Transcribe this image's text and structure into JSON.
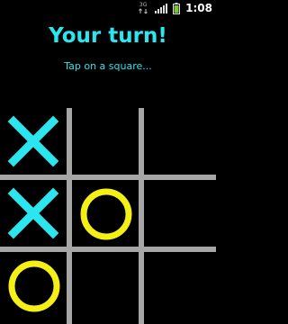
{
  "status_bar": {
    "network_label": "3G",
    "time": "1:08"
  },
  "header": {
    "title": "Your turn!",
    "subtitle": "Tap on a square..."
  },
  "colors": {
    "x_mark": "#2be6ef",
    "o_mark": "#f4ef14",
    "grid": "#a6a6a6",
    "text": "#2be6ef"
  },
  "board": {
    "rows": [
      [
        "X",
        "",
        ""
      ],
      [
        "X",
        "O",
        ""
      ],
      [
        "O",
        "",
        ""
      ]
    ]
  }
}
